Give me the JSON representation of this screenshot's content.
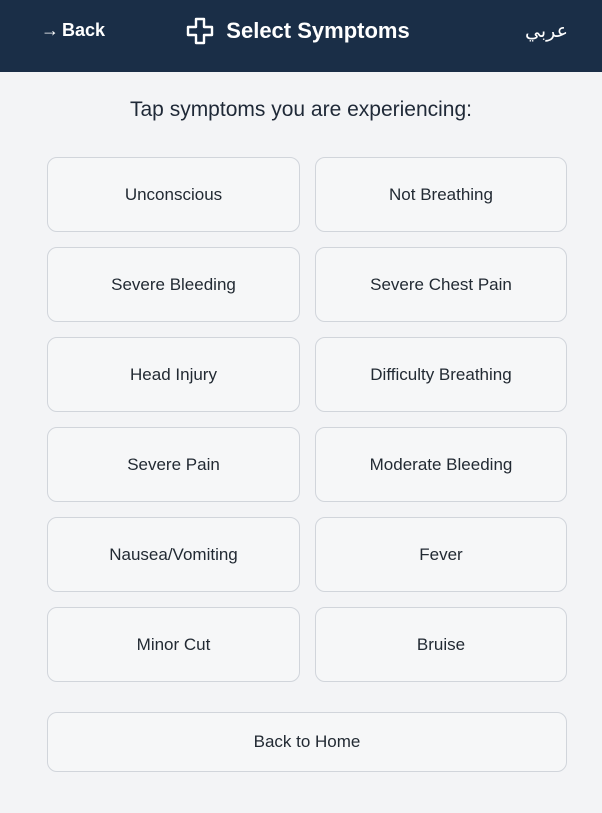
{
  "header": {
    "back_arrow": "→",
    "back_label": "Back",
    "title": "Select Symptoms",
    "title_icon": "medical-cross-icon",
    "language_toggle": "عربي",
    "background_color": "#1a2e47"
  },
  "prompt": "Tap symptoms you are experiencing:",
  "symptoms": [
    {
      "label": "Unconscious"
    },
    {
      "label": "Not Breathing"
    },
    {
      "label": "Severe Bleeding"
    },
    {
      "label": "Severe Chest Pain"
    },
    {
      "label": "Head Injury"
    },
    {
      "label": "Difficulty Breathing"
    },
    {
      "label": "Severe Pain"
    },
    {
      "label": "Moderate Bleeding"
    },
    {
      "label": "Nausea/Vomiting"
    },
    {
      "label": "Fever"
    },
    {
      "label": "Minor Cut"
    },
    {
      "label": "Bruise"
    }
  ],
  "footer": {
    "home_label": "Back to Home"
  }
}
